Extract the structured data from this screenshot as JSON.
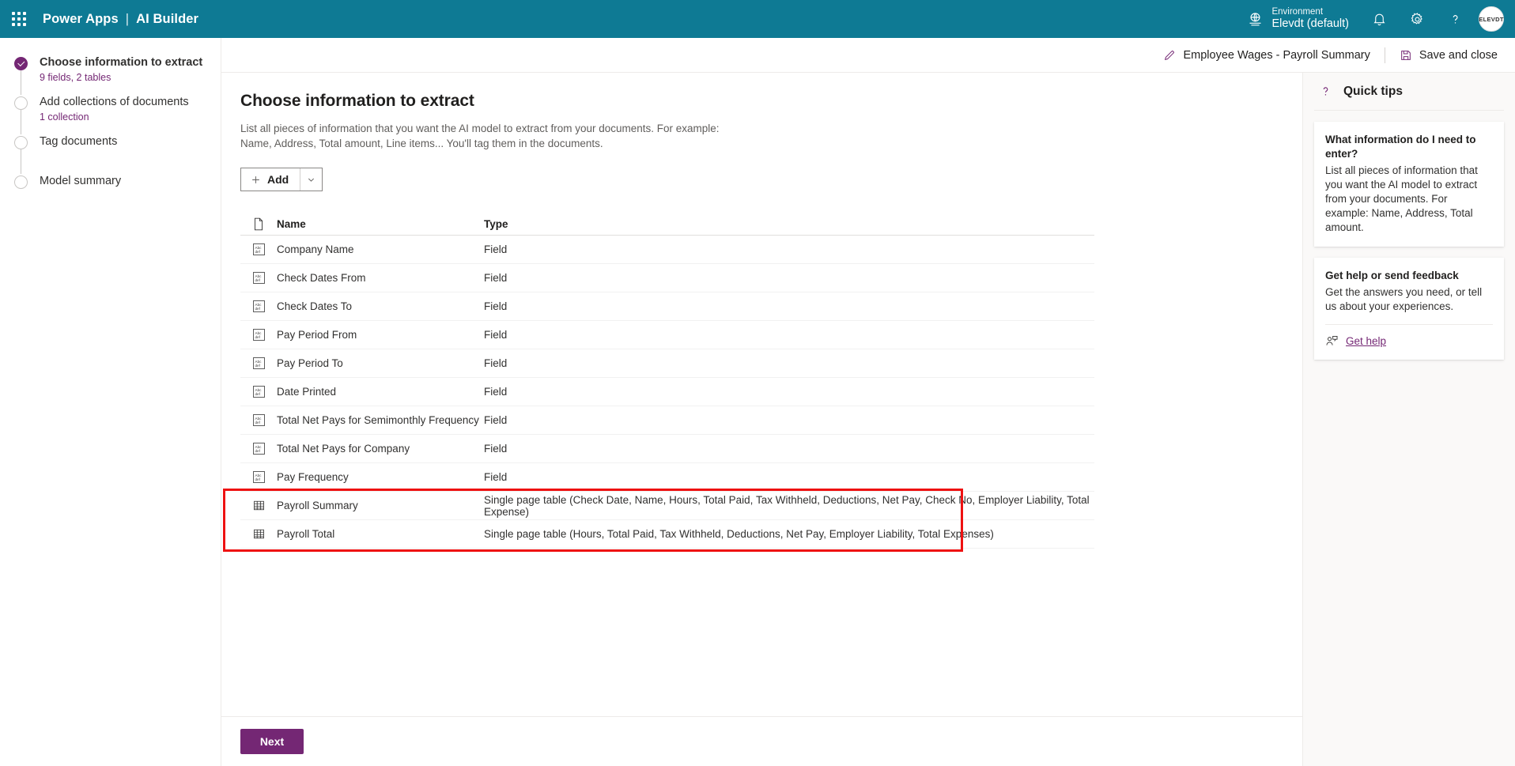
{
  "suite": {
    "waffle_icon": "app-launcher-waffle-icon",
    "brand_app": "Power Apps",
    "brand_separator": "|",
    "brand_product": "AI Builder",
    "environment_label": "Environment",
    "environment_name": "Elevdt (default)",
    "environment_icon": "environment-globe-icon",
    "notifications_icon": "bell-icon",
    "settings_icon": "gear-icon",
    "help_icon": "question-mark-icon",
    "avatar_initials": "ELEVDT"
  },
  "command_bar": {
    "edit_icon": "pencil-icon",
    "model_title": "Employee Wages - Payroll Summary",
    "save_icon": "save-disk-icon",
    "save_label": "Save and close"
  },
  "wizard": {
    "steps": [
      {
        "title": "Choose information to extract",
        "sub": "9 fields, 2 tables",
        "state": "done"
      },
      {
        "title": "Add collections of documents",
        "sub": "1 collection",
        "state": "pending"
      },
      {
        "title": "Tag documents",
        "sub": "",
        "state": "pending"
      },
      {
        "title": "Model summary",
        "sub": "",
        "state": "pending"
      }
    ]
  },
  "main": {
    "title": "Choose information to extract",
    "description": "List all pieces of information that you want the AI model to extract from your documents. For example: Name, Address, Total amount, Line items... You'll tag them in the documents.",
    "add_button_label": "Add",
    "add_button_plus_icon": "plus-icon",
    "add_button_caret_icon": "chevron-down-icon",
    "table": {
      "columns": {
        "icon": "document-page-icon",
        "name": "Name",
        "type": "Type"
      },
      "rows": [
        {
          "icon": "text-field-abc-icon",
          "name": "Company Name",
          "type": "Field",
          "highlighted": false
        },
        {
          "icon": "text-field-abc-icon",
          "name": "Check Dates From",
          "type": "Field",
          "highlighted": false
        },
        {
          "icon": "text-field-abc-icon",
          "name": "Check Dates To",
          "type": "Field",
          "highlighted": false
        },
        {
          "icon": "text-field-abc-icon",
          "name": "Pay Period From",
          "type": "Field",
          "highlighted": false
        },
        {
          "icon": "text-field-abc-icon",
          "name": "Pay Period To",
          "type": "Field",
          "highlighted": false
        },
        {
          "icon": "text-field-abc-icon",
          "name": "Date Printed",
          "type": "Field",
          "highlighted": false
        },
        {
          "icon": "text-field-abc-icon",
          "name": "Total Net Pays for Semimonthly Frequency",
          "type": "Field",
          "highlighted": false
        },
        {
          "icon": "text-field-abc-icon",
          "name": "Total Net Pays for Company",
          "type": "Field",
          "highlighted": false
        },
        {
          "icon": "text-field-abc-icon",
          "name": "Pay Frequency",
          "type": "Field",
          "highlighted": false
        },
        {
          "icon": "table-grid-icon",
          "name": "Payroll Summary",
          "type": "Single page table (Check Date, Name, Hours, Total Paid, Tax Withheld, Deductions, Net Pay, Check No, Employer Liability, Total Expense)",
          "highlighted": true
        },
        {
          "icon": "table-grid-icon",
          "name": "Payroll Total",
          "type": "Single page table (Hours, Total Paid, Tax Withheld, Deductions, Net Pay, Employer Liability, Total Expenses)",
          "highlighted": true
        }
      ]
    }
  },
  "footer": {
    "next_label": "Next"
  },
  "tips": {
    "header_icon": "question-mark-icon",
    "header_title": "Quick tips",
    "cards": [
      {
        "title": "What information do I need to enter?",
        "body": "List all pieces of information that you want the AI model to extract from your documents. For example: Name, Address, Total amount.",
        "link": null,
        "link_icon": null
      },
      {
        "title": "Get help or send feedback",
        "body": "Get the answers you need, or tell us about your experiences.",
        "link": "Get help",
        "link_icon": "person-chat-icon"
      }
    ]
  },
  "colors": {
    "suite_teal": "#0e7a94",
    "accent_purple": "#742774",
    "highlight_red": "#ee1111",
    "panel_bg": "#faf9f8"
  }
}
